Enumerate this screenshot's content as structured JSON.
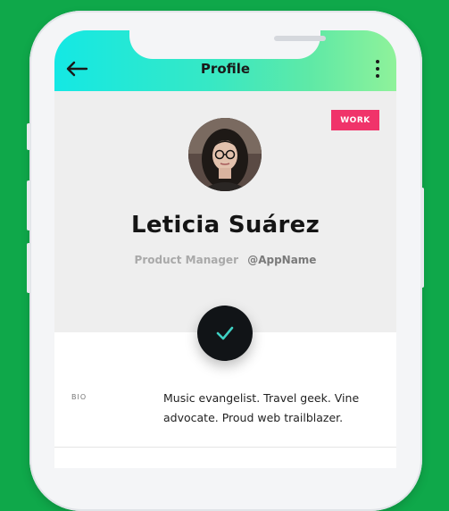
{
  "header": {
    "title": "Profile",
    "back_icon": "arrow-left-icon",
    "menu_icon": "more-vertical-icon"
  },
  "badge": {
    "label": "WORK",
    "color": "#f0336a"
  },
  "profile": {
    "name": "Leticia Suárez",
    "role": "Product Manager",
    "handle": "@AppName"
  },
  "action": {
    "icon": "check-icon",
    "accent": "#3fd1c4"
  },
  "bio": {
    "label": "BIO",
    "text": "Music evangelist. Travel geek. Vine advocate. Proud web trailblazer."
  },
  "colors": {
    "background": "#0fa84a",
    "header_gradient_start": "#14e8e4",
    "header_gradient_end": "#8ff29a"
  }
}
